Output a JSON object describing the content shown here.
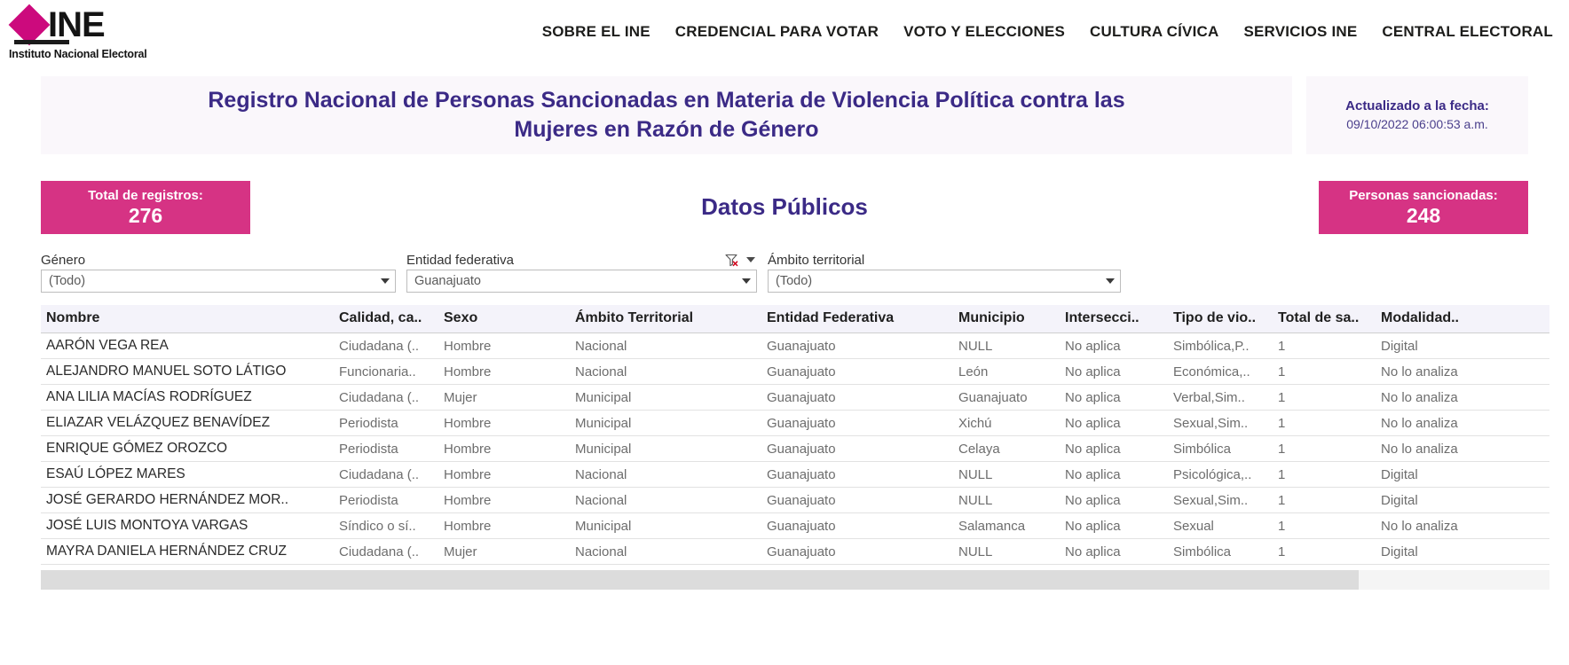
{
  "brand": {
    "acronym": "INE",
    "subtitle": "Instituto Nacional Electoral",
    "accent_color": "#cc0a7d"
  },
  "nav": {
    "items": [
      {
        "label": "SOBRE EL INE"
      },
      {
        "label": "CREDENCIAL PARA VOTAR"
      },
      {
        "label": "VOTO Y ELECCIONES"
      },
      {
        "label": "CULTURA CÍVICA"
      },
      {
        "label": "SERVICIOS INE"
      },
      {
        "label": "CENTRAL ELECTORAL"
      }
    ]
  },
  "header": {
    "title": "Registro Nacional de Personas Sancionadas en Materia de Violencia Política contra las Mujeres en Razón de Género",
    "updated_label": "Actualizado a la fecha:",
    "updated_value": "09/10/2022 06:00:53 a.m.",
    "title_color": "#3b2a86"
  },
  "summary": {
    "section_title": "Datos Públicos",
    "total_records_label": "Total de registros:",
    "total_records_value": "276",
    "sanctioned_label": "Personas sancionadas:",
    "sanctioned_value": "248",
    "badge_color": "#d63384"
  },
  "filters": [
    {
      "label": "Género",
      "value": "(Todo)",
      "has_clear_icon": false
    },
    {
      "label": "Entidad federativa",
      "value": "Guanajuato",
      "has_clear_icon": true
    },
    {
      "label": "Ámbito territorial",
      "value": "(Todo)",
      "has_clear_icon": false
    }
  ],
  "table": {
    "columns": [
      "Nombre",
      "Calidad, ca..",
      "Sexo",
      "Ámbito Territorial",
      "Entidad Federativa",
      "Municipio",
      "Intersecci..",
      "Tipo de vio..",
      "Total de sa..",
      "Modalidad..",
      ""
    ],
    "rows": [
      [
        "AARÓN VEGA REA",
        "Ciudadana (..",
        "Hombre",
        "Nacional",
        "Guanajuato",
        "NULL",
        "No aplica",
        "Simbólica,P..",
        "1",
        "Digital",
        ""
      ],
      [
        "ALEJANDRO MANUEL SOTO LÁTIGO",
        "Funcionaria..",
        "Hombre",
        "Nacional",
        "Guanajuato",
        "León",
        "No aplica",
        "Económica,..",
        "1",
        "No lo analiza",
        ""
      ],
      [
        "ANA LILIA MACÍAS RODRÍGUEZ",
        "Ciudadana (..",
        "Mujer",
        "Municipal",
        "Guanajuato",
        "Guanajuato",
        "No aplica",
        "Verbal,Sim..",
        "1",
        "No lo analiza",
        ""
      ],
      [
        "ELIAZAR VELÁZQUEZ BENAVÍDEZ",
        "Periodista",
        "Hombre",
        "Municipal",
        "Guanajuato",
        "Xichú",
        "No aplica",
        "Sexual,Sim..",
        "1",
        "No lo analiza",
        ""
      ],
      [
        "ENRIQUE GÓMEZ OROZCO",
        "Periodista",
        "Hombre",
        "Municipal",
        "Guanajuato",
        "Celaya",
        "No aplica",
        "Simbólica",
        "1",
        "No lo analiza",
        ""
      ],
      [
        "ESAÚ LÓPEZ MARES",
        "Ciudadana (..",
        "Hombre",
        "Nacional",
        "Guanajuato",
        "NULL",
        "No aplica",
        "Psicológica,..",
        "1",
        "Digital",
        ""
      ],
      [
        "JOSÉ GERARDO HERNÁNDEZ MOR..",
        "Periodista",
        "Hombre",
        "Nacional",
        "Guanajuato",
        "NULL",
        "No aplica",
        "Sexual,Sim..",
        "1",
        "Digital",
        ""
      ],
      [
        "JOSÉ LUIS MONTOYA VARGAS",
        "Síndico o sí..",
        "Hombre",
        "Municipal",
        "Guanajuato",
        "Salamanca",
        "No aplica",
        "Sexual",
        "1",
        "No lo analiza",
        ""
      ],
      [
        "MAYRA DANIELA HERNÁNDEZ CRUZ",
        "Ciudadana (..",
        "Mujer",
        "Nacional",
        "Guanajuato",
        "NULL",
        "No aplica",
        "Simbólica",
        "1",
        "Digital",
        ""
      ]
    ]
  }
}
